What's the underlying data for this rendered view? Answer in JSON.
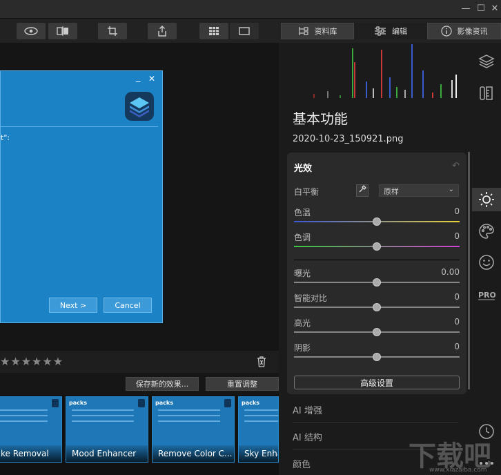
{
  "window": {
    "minimize": "—",
    "maximize": "☐",
    "close": "✕"
  },
  "nav_tabs": [
    {
      "label": "资料库"
    },
    {
      "label": "编辑"
    },
    {
      "label": "影像资讯"
    }
  ],
  "dialog": {
    "fragment": "t\":",
    "minimize": "_",
    "close": "✕",
    "next_label": "Next >",
    "cancel_label": "Cancel"
  },
  "rating": {
    "stars": "★★★★★★",
    "count": 6
  },
  "actions": {
    "save_label": "保存新的效果...",
    "reset_label": "重置调整"
  },
  "presets": [
    {
      "label": "ke Removal",
      "head": "packs"
    },
    {
      "label": "Mood Enhancer",
      "head": "packs"
    },
    {
      "label": "Remove Color C...",
      "head": "packs"
    },
    {
      "label": "Sky Enha",
      "head": "packs"
    }
  ],
  "panel": {
    "title": "基本功能",
    "filename": "2020-10-23_150921.png",
    "card_title": "光效",
    "white_balance_label": "白平衡",
    "white_balance_value": "原样",
    "sliders": [
      {
        "label": "色温",
        "value": "0",
        "position": 0.5
      },
      {
        "label": "色调",
        "value": "0",
        "position": 0.5
      },
      {
        "label": "曝光",
        "value": "0.00",
        "position": 0.5
      },
      {
        "label": "智能对比",
        "value": "0",
        "position": 0.5
      },
      {
        "label": "高光",
        "value": "0",
        "position": 0.5
      },
      {
        "label": "阴影",
        "value": "0",
        "position": 0.5
      }
    ],
    "advanced_label": "高级设置",
    "sections": [
      "AI 增强",
      "AI 结构",
      "颜色"
    ]
  },
  "watermark": {
    "main": "下载吧",
    "sub": "www.xiazaiba.com"
  },
  "colors": {
    "accent_dialog": "#1b82c6",
    "temp_gradient": [
      "#3d55d6",
      "#e6d43a"
    ],
    "tint_gradient": [
      "#38c93c",
      "#d33fd6"
    ]
  }
}
